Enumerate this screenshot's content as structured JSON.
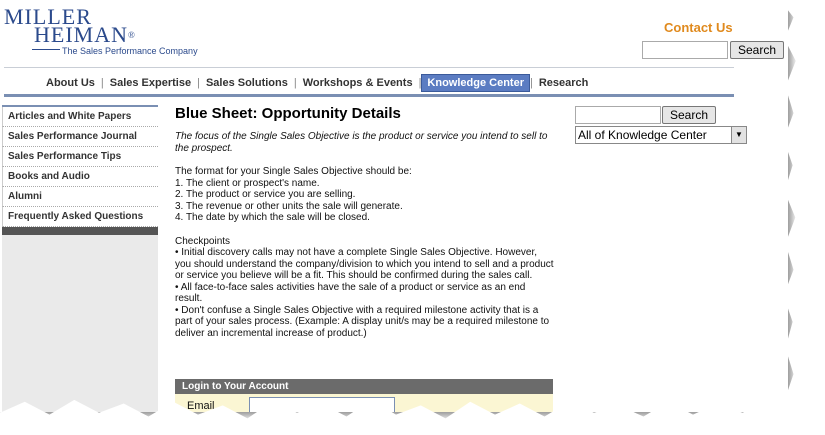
{
  "logo": {
    "line1": "MILLER",
    "line2": "HEIMAN",
    "registered": "®",
    "tagline": "The Sales Performance Company"
  },
  "header": {
    "contact_label": "Contact Us",
    "search_value": "",
    "search_button": "Search"
  },
  "nav": {
    "items": [
      {
        "label": "About Us"
      },
      {
        "label": "Sales Expertise"
      },
      {
        "label": "Sales Solutions"
      },
      {
        "label": "Workshops & Events"
      },
      {
        "label": "Knowledge Center"
      },
      {
        "label": "Research"
      }
    ],
    "active_index": 4,
    "separator": "|"
  },
  "sidebar": {
    "items": [
      {
        "label": "Articles and White Papers"
      },
      {
        "label": "Sales Performance Journal"
      },
      {
        "label": "Sales Performance Tips"
      },
      {
        "label": "Books and Audio"
      },
      {
        "label": "Alumni"
      },
      {
        "label": "Frequently Asked Questions"
      }
    ]
  },
  "main": {
    "title": "Blue Sheet: Opportunity Details",
    "intro": "The focus of the Single Sales Objective is the product or service you intend to sell to the prospect.",
    "format_heading": "The format for your Single Sales Objective should be:",
    "format_items": [
      "1. The client or prospect's name.",
      "2. The product or service you are selling.",
      "3. The revenue or other units the sale will generate.",
      "4. The date by which the sale will be closed."
    ],
    "checkpoints_heading": "Checkpoints",
    "checkpoints": [
      "• Initial discovery calls may not have a complete Single Sales Objective. However, you should understand the company/division to which you intend to sell and a product or service you believe will be a fit. This should be confirmed during the sales call.",
      "• All face-to-face sales activities have the sale of a product or service as an end result.",
      "• Don't confuse a Single Sales Objective with a required milestone activity that is a part of your sales process. (Example: A display unit/s may be a required milestone to deliver an incremental increase of product.)"
    ]
  },
  "login": {
    "heading": "Login to Your Account",
    "email_label": "Email",
    "email_value": ""
  },
  "side_search": {
    "value": "",
    "button": "Search",
    "scope_selected": "All of Knowledge Center"
  },
  "colors": {
    "brand": "#2b4a8c",
    "contact": "#e08a1e",
    "nav_active": "#5b7cc2",
    "login_bg": "#fbf6d3"
  }
}
